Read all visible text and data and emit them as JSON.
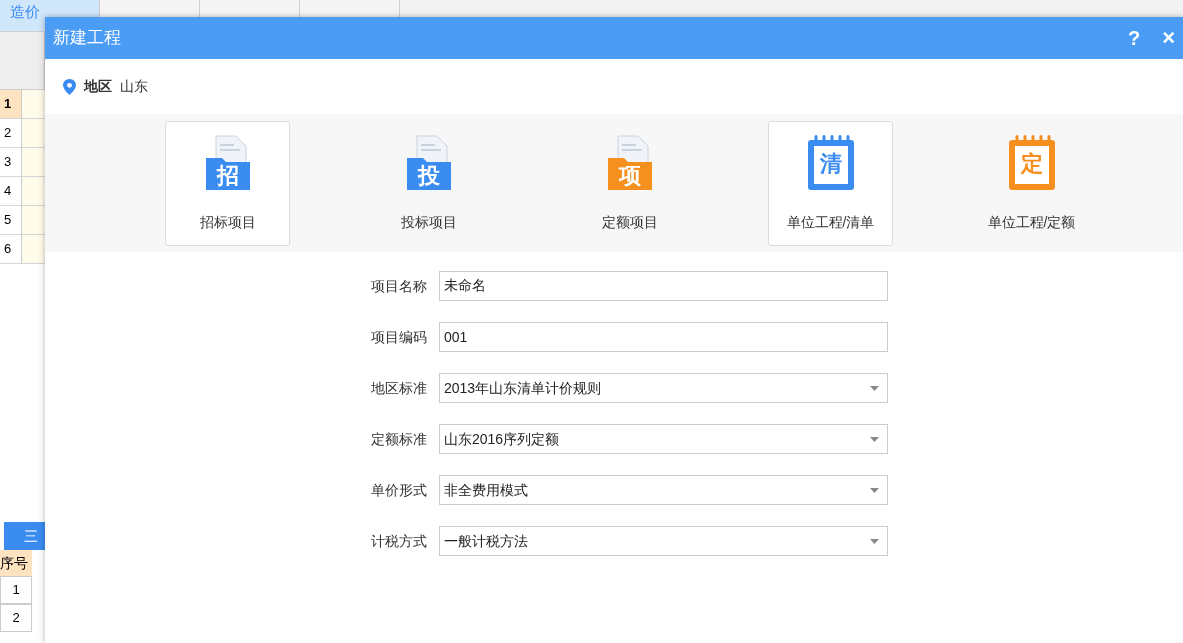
{
  "background": {
    "tabs": [
      {
        "label": "造价",
        "selected": true
      },
      {
        "selected": false
      },
      {
        "selected": false
      },
      {
        "selected": false
      }
    ],
    "rows": [
      {
        "number": "1",
        "selected": true
      },
      {
        "number": "2",
        "selected": false
      },
      {
        "number": "3",
        "selected": false
      },
      {
        "number": "4",
        "selected": false
      },
      {
        "number": "5",
        "selected": false
      },
      {
        "number": "6",
        "selected": false
      }
    ],
    "bottom_tab": "三",
    "bottom_header": "序号",
    "bottom_rows": [
      "1",
      "2"
    ]
  },
  "dialog": {
    "title": "新建工程",
    "help": "?",
    "close": "×",
    "region_label": "地区",
    "region_value": "山东",
    "project_types": [
      {
        "label": "招标项目",
        "icon_char": "招",
        "color": "#3b8cf0",
        "kind": "folder",
        "selected": true
      },
      {
        "label": "投标项目",
        "icon_char": "投",
        "color": "#3b8cf0",
        "kind": "folder",
        "selected": false
      },
      {
        "label": "定额项目",
        "icon_char": "项",
        "color": "#f5901e",
        "kind": "folder",
        "selected": false
      },
      {
        "label": "单位工程/清单",
        "icon_char": "清",
        "color": "#3b8cf0",
        "kind": "notebook",
        "selected": true
      },
      {
        "label": "单位工程/定额",
        "icon_char": "定",
        "color": "#f5901e",
        "kind": "notebook",
        "selected": false
      }
    ],
    "fields": [
      {
        "label": "项目名称",
        "value": "未命名",
        "kind": "text"
      },
      {
        "label": "项目编码",
        "value": "001",
        "kind": "text"
      },
      {
        "label": "地区标准",
        "value": "2013年山东清单计价规则",
        "kind": "select"
      },
      {
        "label": "定额标准",
        "value": "山东2016序列定额",
        "kind": "select"
      },
      {
        "label": "单价形式",
        "value": "非全费用模式",
        "kind": "select"
      },
      {
        "label": "计税方式",
        "value": "一般计税方法",
        "kind": "select"
      }
    ]
  }
}
